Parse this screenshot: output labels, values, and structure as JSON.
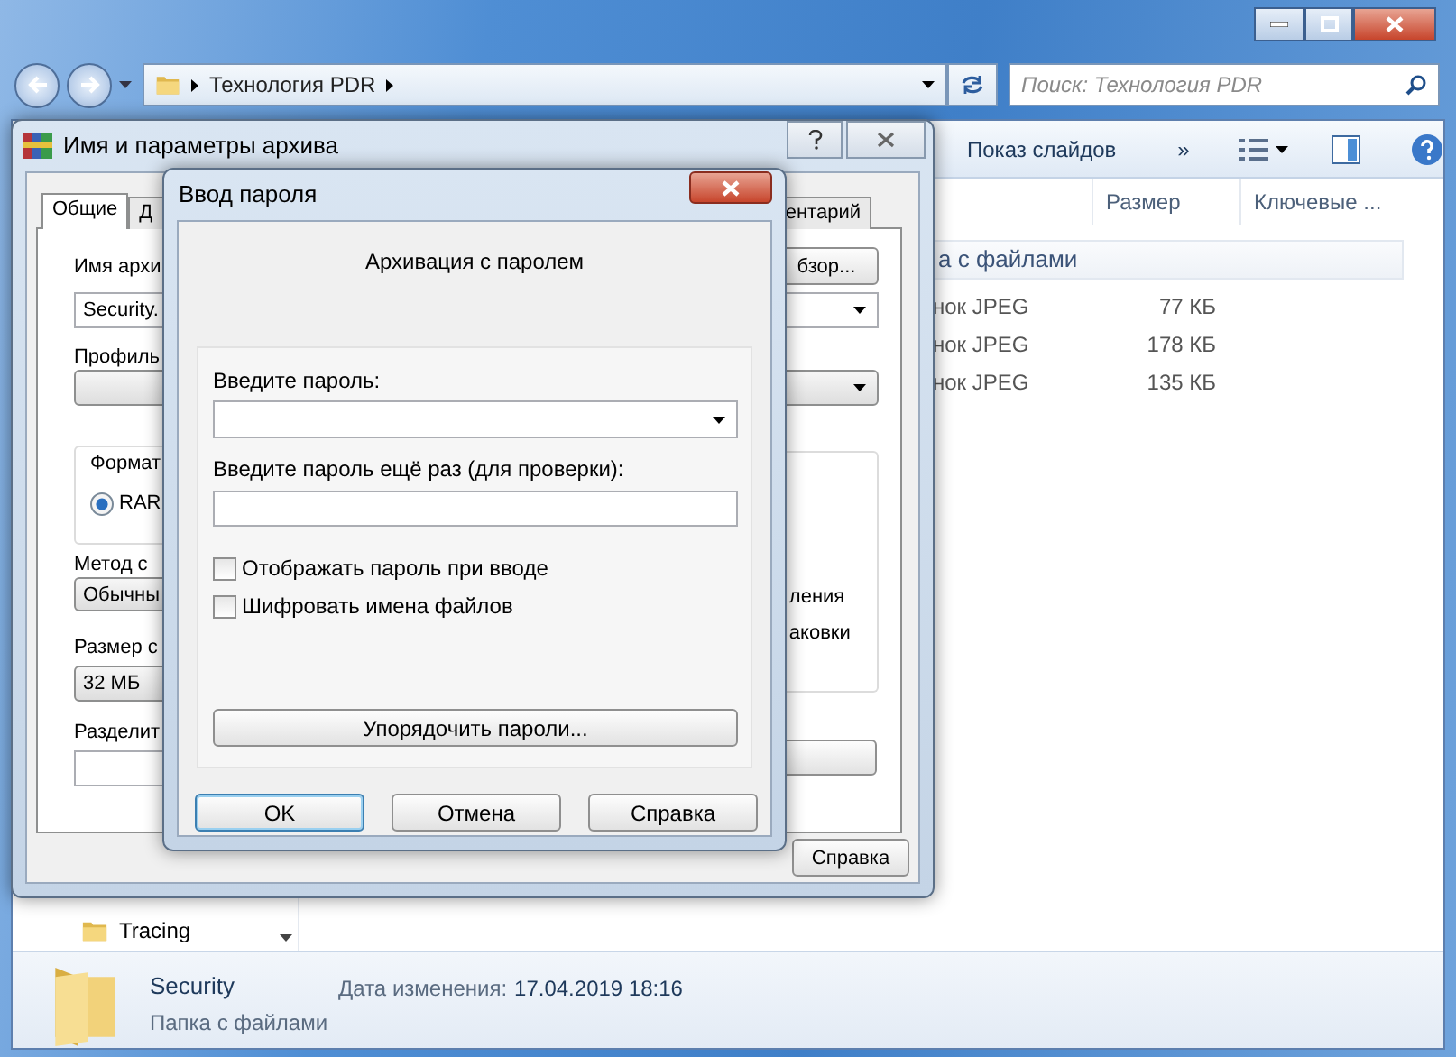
{
  "explorer": {
    "address_path": [
      "Технология PDR"
    ],
    "search": {
      "placeholder": "Поиск: Технология PDR"
    },
    "toolbar": [
      "Показ слайдов",
      "»"
    ],
    "columns": [
      "Размер",
      "Ключевые ..."
    ],
    "group": "а с файлами",
    "files": [
      {
        "type": "нок JPEG",
        "size": "77 КБ"
      },
      {
        "type": "нок JPEG",
        "size": "178 КБ"
      },
      {
        "type": "нок JPEG",
        "size": "135 КБ"
      }
    ],
    "nav_items": [
      {
        "label": "Tracing"
      }
    ],
    "details": {
      "name": "Security",
      "kind": "Папка с файлами",
      "date_label": "Дата изменения:",
      "date": "17.04.2019 18:16"
    }
  },
  "archive_dialog": {
    "title": "Имя и параметры архива",
    "tabs": [
      {
        "label": "Общие",
        "selected": true
      },
      {
        "label": "Д",
        "selected": false
      },
      {
        "label": "ентарий",
        "selected": false
      }
    ],
    "name_label": "Имя архи",
    "browse_button": "бзор...",
    "name_value": "Security.",
    "profile_label": "Профиль",
    "format_label": "Формат",
    "formats": [
      {
        "label": "RAR",
        "selected": true
      }
    ],
    "method_label": "Метод с",
    "method_value": "Обычны",
    "dict_label": "Размер с",
    "dict_value": "32 МБ",
    "split_label": "Разделит",
    "option_texts": [
      "ления",
      "аковки"
    ],
    "help_button": "Справка"
  },
  "password_dialog": {
    "title": "Ввод пароля",
    "heading": "Архивация с паролем",
    "password_label": "Введите пароль:",
    "confirm_label": "Введите пароль ещё раз (для проверки):",
    "checkboxes": [
      {
        "label": "Отображать пароль при вводе",
        "checked": false
      },
      {
        "label": "Шифровать имена файлов",
        "checked": false
      }
    ],
    "manage_button": "Упорядочить пароли...",
    "buttons": [
      {
        "label": "OK",
        "default": true
      },
      {
        "label": "Отмена",
        "default": false
      },
      {
        "label": "Справка",
        "default": false
      }
    ]
  }
}
